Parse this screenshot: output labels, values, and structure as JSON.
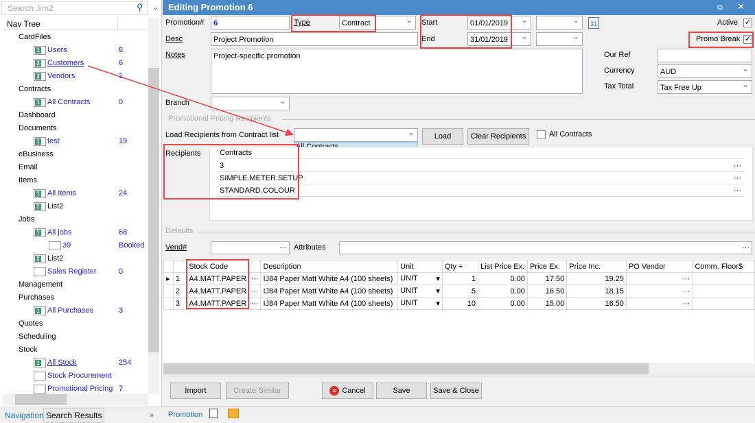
{
  "nav": {
    "search_placeholder": "Search Jim2",
    "header": "Nav Tree",
    "items": [
      {
        "label": "CardFiles",
        "level": 0
      },
      {
        "label": "Users",
        "level": 1,
        "badge": "1",
        "count": "6"
      },
      {
        "label": "Customers",
        "level": 1,
        "badge": "2",
        "count": "6",
        "underline": true
      },
      {
        "label": "Vendors",
        "level": 1,
        "badge": "3",
        "count": "1"
      },
      {
        "label": "Contracts",
        "level": 0
      },
      {
        "label": "All Contracts",
        "level": 1,
        "badge": "1",
        "count": "0"
      },
      {
        "label": "Dashboard",
        "level": 0
      },
      {
        "label": "Documents",
        "level": 0
      },
      {
        "label": "test",
        "level": 1,
        "badge": "1",
        "count": "19"
      },
      {
        "label": "eBusiness",
        "level": 0
      },
      {
        "label": "Email",
        "level": 0
      },
      {
        "label": "Items",
        "level": 0
      },
      {
        "label": "All Items",
        "level": 1,
        "badge": "1",
        "count": "24"
      },
      {
        "label": "List2",
        "level": 1,
        "badge": "2",
        "plain": true
      },
      {
        "label": "Jobs",
        "level": 0
      },
      {
        "label": "All jobs",
        "level": 1,
        "badge": "1",
        "count": "68"
      },
      {
        "label": "39",
        "level": 2,
        "count": "Booked"
      },
      {
        "label": "List2",
        "level": 1,
        "badge": "2",
        "plain": true
      },
      {
        "label": "Sales Register",
        "level": 1,
        "count": "0"
      },
      {
        "label": "Management",
        "level": 0
      },
      {
        "label": "Purchases",
        "level": 0
      },
      {
        "label": "All Purchases",
        "level": 1,
        "badge": "1",
        "count": "3"
      },
      {
        "label": "Quotes",
        "level": 0
      },
      {
        "label": "Scheduling",
        "level": 0
      },
      {
        "label": "Stock",
        "level": 0
      },
      {
        "label": "All Stock",
        "level": 1,
        "badge": "1",
        "count": "254",
        "underline": true
      },
      {
        "label": "Stock Procurement",
        "level": 1
      },
      {
        "label": "Promotional Pricing",
        "level": 1,
        "count": "7"
      }
    ],
    "tabs": [
      "Navigation",
      "Search Results"
    ]
  },
  "form": {
    "title": "Editing Promotion 6",
    "promotion_label": "Promotion#",
    "promotion_value": "6",
    "type_label": "Type",
    "type_value": "Contract",
    "start_label": "Start",
    "start_value": "01/01/2019",
    "end_label": "End",
    "end_value": "31/01/2019",
    "calendar_day": "31",
    "active_label": "Active",
    "promo_break_label": "Promo Break",
    "desc_label": "Desc",
    "desc_value": "Project Promotion",
    "notes_label": "Notes",
    "notes_value": "Project-specific promotion",
    "ourref_label": "Our Ref",
    "currency_label": "Currency",
    "currency_value": "AUD",
    "taxtotal_label": "Tax Total",
    "taxtotal_value": "Tax Free Up",
    "branch_label": "Branch",
    "recipients_section": "Promotional Pricing Recipients",
    "load_label": "Load Recipients from Contract list",
    "load_option": "All Contracts",
    "load_button": "Load",
    "clear_button": "Clear Recipients",
    "all_contracts_label": "All Contracts",
    "recipients_label": "Recipients",
    "contracts_header": "Contracts",
    "contracts": [
      "3",
      "SIMPLE.METER.SETUP",
      "STANDARD.COLOUR"
    ],
    "defaults_section": "Defaults",
    "vend_label": "Vend#",
    "attributes_label": "Attributes"
  },
  "grid": {
    "headers": [
      "Stock Code",
      "Description",
      "Unit",
      "Qty +",
      "List Price Ex.",
      "Price Ex.",
      "Price Inc.",
      "PO Vendor",
      "Comm. Floor$"
    ],
    "rows": [
      {
        "n": "1",
        "code": "A4.MATT.PAPER",
        "desc": "IJ84 Paper Matt White A4 (100 sheets)",
        "unit": "UNIT",
        "qty": "1",
        "list": "0.00",
        "ex": "17.50",
        "inc": "19.25"
      },
      {
        "n": "2",
        "code": "A4.MATT.PAPER",
        "desc": "IJ84 Paper Matt White A4 (100 sheets)",
        "unit": "UNIT",
        "qty": "5",
        "list": "0.00",
        "ex": "16.50",
        "inc": "18.15"
      },
      {
        "n": "3",
        "code": "A4.MATT.PAPER",
        "desc": "IJ84 Paper Matt White A4 (100 sheets)",
        "unit": "UNIT",
        "qty": "10",
        "list": "0.00",
        "ex": "15.00",
        "inc": "16.50"
      }
    ]
  },
  "buttons": {
    "import": "Import",
    "create_similar": "Create Similar",
    "cancel": "Cancel",
    "save": "Save",
    "save_close": "Save & Close"
  },
  "bottom_tab": "Promotion",
  "colors": {
    "titlebar": "#4a8ac9",
    "link": "#1a1aff",
    "annotation": "#ef4444"
  }
}
